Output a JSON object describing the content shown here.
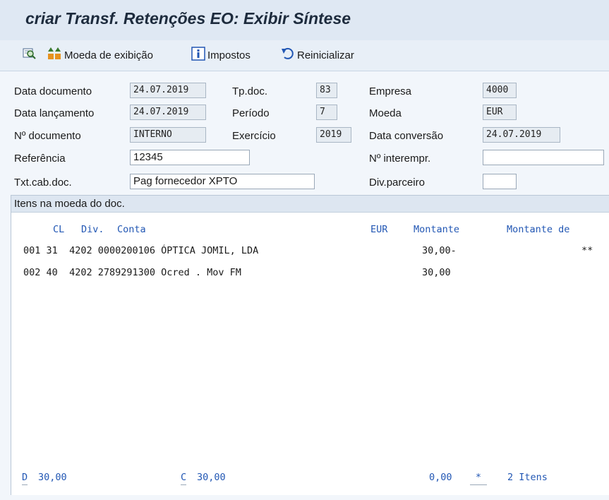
{
  "window": {
    "title": "criar Transf. Retenções EO: Exibir Síntese"
  },
  "toolbar": {
    "moeda_label": "Moeda de exibição",
    "impostos_label": "Impostos",
    "reinicializar_label": "Reinicializar"
  },
  "header": {
    "data_documento": {
      "label": "Data documento",
      "value": "24.07.2019"
    },
    "data_lancamento": {
      "label": "Data lançamento",
      "value": "24.07.2019"
    },
    "n_documento": {
      "label": "Nº documento",
      "value": "INTERNO"
    },
    "referencia": {
      "label": "Referência",
      "value": "12345"
    },
    "txt_cab_doc": {
      "label": "Txt.cab.doc.",
      "value": "Pag fornecedor XPTO"
    },
    "tp_doc": {
      "label": "Tp.doc.",
      "value": "83"
    },
    "periodo": {
      "label": "Período",
      "value": "7"
    },
    "exercicio": {
      "label": "Exercício",
      "value": "2019"
    },
    "empresa": {
      "label": "Empresa",
      "value": "4000"
    },
    "moeda": {
      "label": "Moeda",
      "value": "EUR"
    },
    "data_conversao": {
      "label": "Data conversão",
      "value": "24.07.2019"
    },
    "n_interempr": {
      "label": "Nº interempr.",
      "value": ""
    },
    "div_parceiro": {
      "label": "Div.parceiro",
      "value": ""
    }
  },
  "items": {
    "section_title": "Itens na moeda do doc.",
    "columns": {
      "cl": "CL",
      "div": "Div.",
      "conta": "Conta",
      "currency": "EUR",
      "montante": "Montante",
      "montante_de": "Montante de"
    },
    "rows": [
      {
        "pos": "001",
        "cl": "31",
        "div": "4202",
        "conta": "0000200106",
        "name": "ÓPTICA JOMIL, LDA",
        "montante": "30,00-",
        "flag": "**"
      },
      {
        "pos": "002",
        "cl": "40",
        "div": "4202",
        "conta": "2789291300",
        "name": "Ocred . Mov FM",
        "montante": "30,00",
        "flag": ""
      }
    ],
    "footer": {
      "d_label": "D",
      "d_value": "30,00",
      "c_label": "C",
      "c_value": "30,00",
      "balance": "0,00",
      "balance_flag": "*",
      "count": "2 Itens"
    }
  },
  "colors": {
    "title_bg": "#dfe8f3",
    "form_bg": "#f2f6fb",
    "accent_blue": "#2257b4"
  }
}
